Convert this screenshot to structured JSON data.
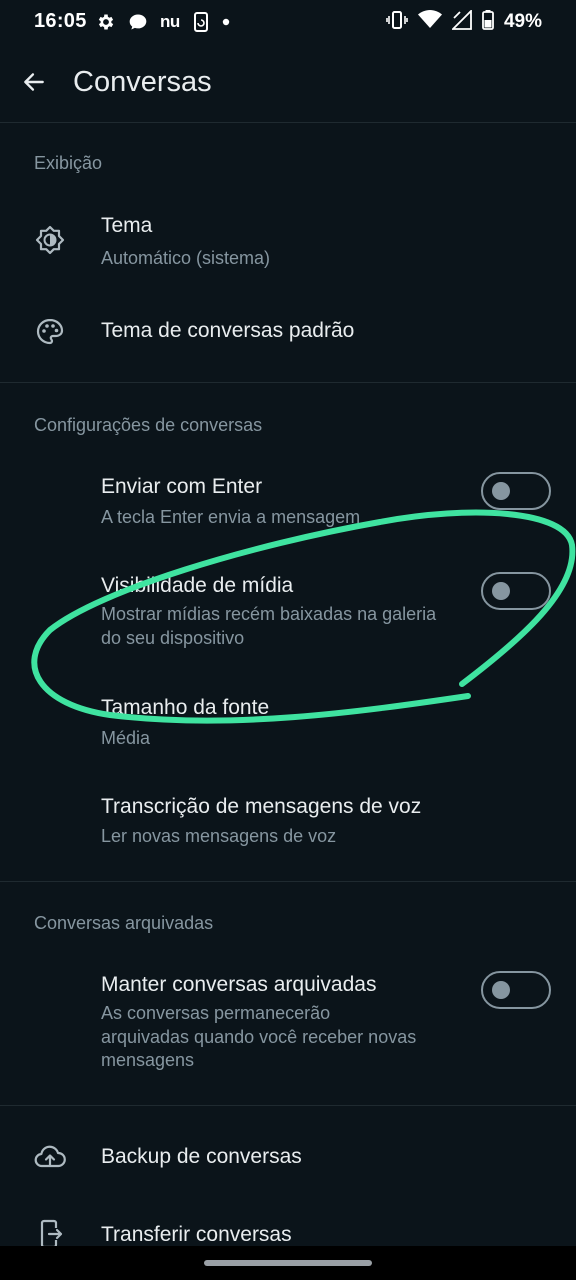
{
  "status_bar": {
    "time": "16:05",
    "carrier_label": "nu",
    "battery": "49%",
    "left_icons": [
      "settings-gear-icon",
      "chat-bubble-icon",
      "nu-app-icon",
      "phone-rotation-icon",
      "dot-icon"
    ],
    "right_icons": [
      "vibrate-icon",
      "wifi-icon",
      "signal-icon",
      "battery-icon"
    ]
  },
  "app_bar": {
    "title": "Conversas",
    "back_icon": "arrow-back-icon"
  },
  "sections": {
    "display": {
      "header": "Exibição",
      "theme": {
        "icon": "brightness-theme-icon",
        "title": "Tema",
        "subtitle": "Automático (sistema)"
      },
      "chat_theme": {
        "icon": "palette-icon",
        "title": "Tema de conversas padrão"
      }
    },
    "chat_settings": {
      "header": "Configurações de conversas",
      "enter_send": {
        "title": "Enviar com Enter",
        "subtitle": "A tecla Enter envia a mensagem",
        "enabled": false
      },
      "media_visibility": {
        "title": "Visibilidade de mídia",
        "subtitle": "Mostrar mídias recém baixadas na galeria do seu dispositivo",
        "enabled": false
      },
      "font_size": {
        "title": "Tamanho da fonte",
        "subtitle": "Média"
      },
      "voice_transcription": {
        "title": "Transcrição de mensagens de voz",
        "subtitle": "Ler novas mensagens de voz"
      }
    },
    "archived": {
      "header": "Conversas arquivadas",
      "keep_archived": {
        "title": "Manter conversas arquivadas",
        "subtitle": "As conversas permanecerão arquivadas quando você receber novas mensagens",
        "enabled": false
      }
    },
    "backup": {
      "icon": "cloud-upload-icon",
      "title": "Backup de conversas"
    },
    "transfer": {
      "icon": "transfer-phone-icon",
      "title": "Transferir conversas"
    }
  },
  "colors": {
    "background": "#0b141a",
    "primary_text": "#e9edef",
    "secondary_text": "#8696a0",
    "annotation_stroke": "#3fe3a0"
  }
}
